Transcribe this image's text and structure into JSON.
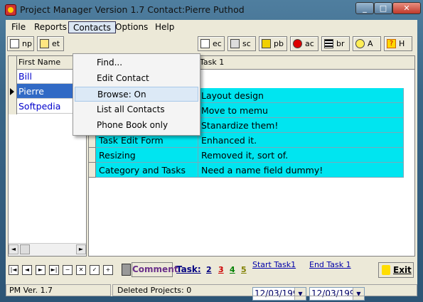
{
  "window": {
    "title": "Project Manager Version 1.7    Contact:Pierre Puthod",
    "minimize": "_",
    "maximize": "□",
    "close": "✕"
  },
  "menubar": {
    "items": [
      "File",
      "Reports",
      "Contacts",
      "Options",
      "Help"
    ]
  },
  "toolbar": {
    "left": [
      {
        "label": "np",
        "icon": "new-project-icon"
      },
      {
        "label": "et",
        "icon": "edit-task-icon"
      }
    ],
    "right": [
      {
        "label": "ec",
        "icon": "edit-contact-icon"
      },
      {
        "label": "sc",
        "icon": "select-contact-icon"
      },
      {
        "label": "pb",
        "icon": "phone-book-icon"
      },
      {
        "label": "ac",
        "icon": "all-contacts-icon"
      },
      {
        "label": "br",
        "icon": "browse-icon"
      },
      {
        "label": "A",
        "icon": "lightbulb-icon"
      },
      {
        "label": "H",
        "icon": "help-icon"
      }
    ]
  },
  "contacts_menu": {
    "items": [
      "Find...",
      "Edit Contact",
      "Browse: On",
      "List all Contacts",
      "Phone Book only"
    ]
  },
  "contacts_grid": {
    "header": "First Name",
    "rows": [
      "Bill",
      "Pierre",
      "Softpedia"
    ],
    "selected_index": 1
  },
  "tasks_grid": {
    "header": "Task 1",
    "rows": [
      {
        "name": "",
        "task": "Layout design"
      },
      {
        "name": "",
        "task": "Move to memu"
      },
      {
        "name": "",
        "task": "Stanardize them!"
      },
      {
        "name": "Task Edit Form",
        "task": "Enhanced it."
      },
      {
        "name": "Resizing",
        "task": "Removed it, sort of."
      },
      {
        "name": "Category and Tasks",
        "task": "Need a name field dummy!"
      }
    ]
  },
  "bottom": {
    "nav_buttons": [
      "|◄",
      "◄",
      "►",
      "►|",
      "−",
      "✕",
      "✓",
      "+"
    ],
    "comment_label": "Comment",
    "task_label": "Task:",
    "task_numbers": [
      "2",
      "3",
      "4",
      "5"
    ],
    "task_number_colors": [
      "#000080",
      "#cc0000",
      "#008000",
      "#808000"
    ],
    "start_label": "Start Task1",
    "start_date": "12/03/199",
    "end_label": "End Task 1",
    "end_date": "12/03/199",
    "exit_label": "Exit"
  },
  "statusbar": {
    "version": "PM Ver. 1.7",
    "deleted": "Deleted Projects:  0"
  }
}
